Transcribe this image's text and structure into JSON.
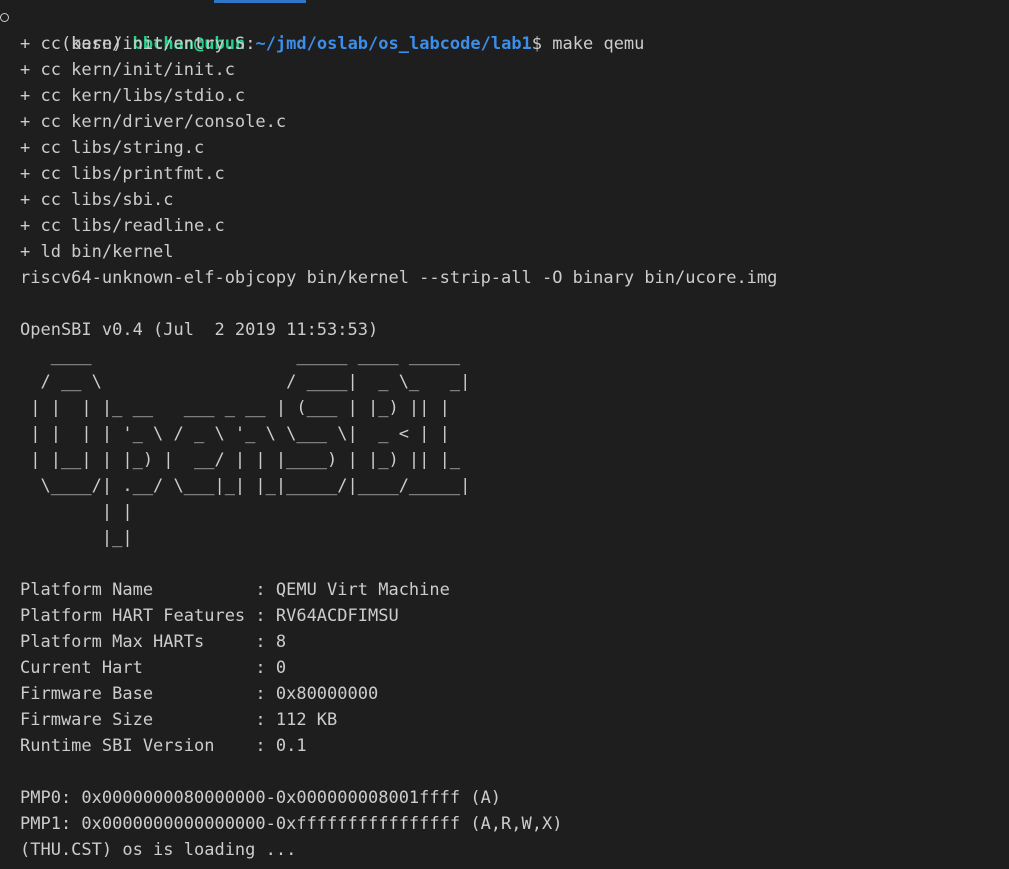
{
  "terminal": {
    "prompt": {
      "env": "(base) ",
      "user_host": "bbchan@ubun",
      "colon": ":",
      "path": "~/jmd/oslab/os_labcode/lab1",
      "symbol": "$ ",
      "command": "make qemu"
    },
    "build_output": [
      "+ cc kern/init/entry.S",
      "+ cc kern/init/init.c",
      "+ cc kern/libs/stdio.c",
      "+ cc kern/driver/console.c",
      "+ cc libs/string.c",
      "+ cc libs/printfmt.c",
      "+ cc libs/sbi.c",
      "+ cc libs/readline.c",
      "+ ld bin/kernel",
      "riscv64-unknown-elf-objcopy bin/kernel --strip-all -O binary bin/ucore.img"
    ],
    "opensbi_banner": "OpenSBI v0.4 (Jul  2 2019 11:53:53)",
    "ascii_art": [
      "   ____                    _____ ____ _____",
      "  / __ \\                  / ____|  _ \\_   _|",
      " | |  | |_ __   ___ _ __ | (___ | |_) || |",
      " | |  | | '_ \\ / _ \\ '_ \\ \\___ \\|  _ < | |",
      " | |__| | |_) |  __/ | | |____) | |_) || |_",
      "  \\____/| .__/ \\___|_| |_|_____/|____/_____|",
      "        | |",
      "        |_|"
    ],
    "platform_info": [
      "Platform Name          : QEMU Virt Machine",
      "Platform HART Features : RV64ACDFIMSU",
      "Platform Max HARTs     : 8",
      "Current Hart           : 0",
      "Firmware Base          : 0x80000000",
      "Firmware Size          : 112 KB",
      "Runtime SBI Version    : 0.1"
    ],
    "pmp_info": [
      "PMP0: 0x0000000080000000-0x000000008001ffff (A)",
      "PMP1: 0x0000000000000000-0xffffffffffffffff (A,R,W,X)"
    ],
    "final_line": "(THU.CST) os is loading ..."
  }
}
